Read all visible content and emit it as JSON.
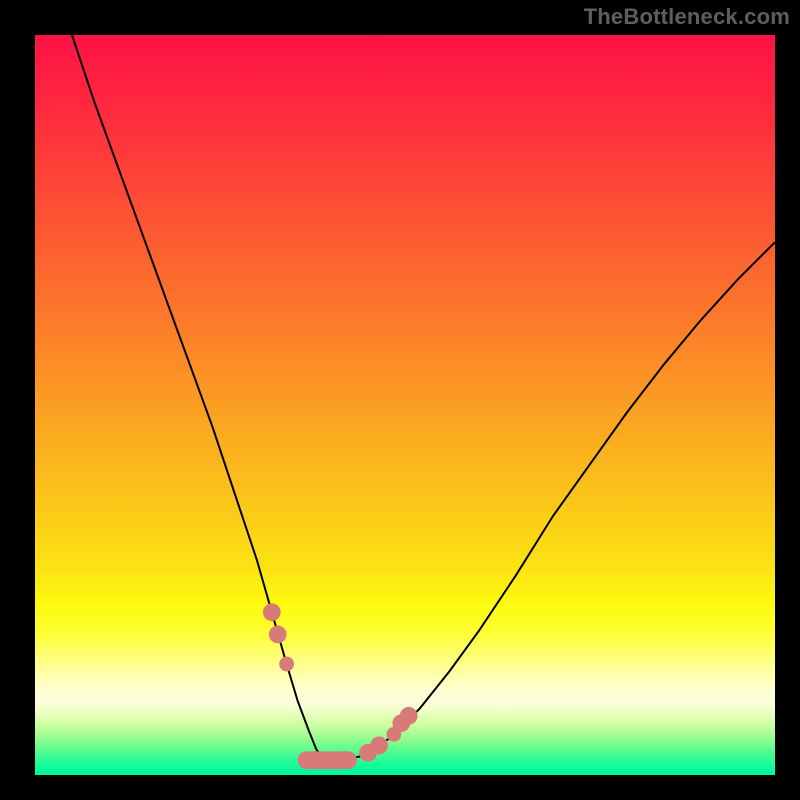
{
  "watermark": "TheBottleneck.com",
  "colors": {
    "marker": "#d87a77",
    "curve": "#000000",
    "frame": "#000000"
  },
  "gradient_stops": [
    {
      "offset": 0.0,
      "color": "#fe1245"
    },
    {
      "offset": 0.12,
      "color": "#fe2f3c"
    },
    {
      "offset": 0.25,
      "color": "#fd5433"
    },
    {
      "offset": 0.38,
      "color": "#fc792b"
    },
    {
      "offset": 0.5,
      "color": "#fb9e22"
    },
    {
      "offset": 0.62,
      "color": "#fbc31a"
    },
    {
      "offset": 0.72,
      "color": "#fbe313"
    },
    {
      "offset": 0.77,
      "color": "#fdfb0e"
    },
    {
      "offset": 0.808,
      "color": "#feff34"
    },
    {
      "offset": 0.848,
      "color": "#ffff89"
    },
    {
      "offset": 0.872,
      "color": "#ffffb9"
    },
    {
      "offset": 0.888,
      "color": "#ffffd5"
    },
    {
      "offset": 0.9,
      "color": "#fdffdb"
    },
    {
      "offset": 0.912,
      "color": "#f1ffc8"
    },
    {
      "offset": 0.924,
      "color": "#defeb1"
    },
    {
      "offset": 0.936,
      "color": "#c2fd9e"
    },
    {
      "offset": 0.948,
      "color": "#9efd91"
    },
    {
      "offset": 0.96,
      "color": "#71fc8e"
    },
    {
      "offset": 0.975,
      "color": "#3dfb94"
    },
    {
      "offset": 0.99,
      "color": "#0cfb9b"
    },
    {
      "offset": 1.0,
      "color": "#00f79d"
    }
  ],
  "chart_data": {
    "type": "line",
    "title": "",
    "xlabel": "",
    "ylabel": "",
    "xlim": [
      0,
      100
    ],
    "ylim": [
      0,
      100
    ],
    "series": [
      {
        "name": "bottleneck-curve",
        "x": [
          5,
          8,
          12,
          16,
          20,
          24,
          27,
          30,
          32,
          34,
          35.5,
          37,
          38,
          39,
          40,
          44,
          48,
          52,
          56,
          60,
          65,
          70,
          75,
          80,
          85,
          90,
          95,
          100
        ],
        "y": [
          100,
          91,
          80,
          69,
          58,
          47,
          38,
          29,
          22,
          15,
          10,
          6,
          3.5,
          2,
          2,
          2.5,
          5,
          9,
          14,
          19.5,
          27,
          35,
          42,
          49,
          55.5,
          61.5,
          67,
          72
        ]
      }
    ],
    "markers": [
      {
        "x": 32.0,
        "y": 22.0,
        "r": 1.2
      },
      {
        "x": 32.8,
        "y": 19.0,
        "r": 1.2
      },
      {
        "x": 34.0,
        "y": 15.0,
        "r": 1.0
      },
      {
        "x": 45.0,
        "y": 3.0,
        "r": 1.2
      },
      {
        "x": 46.5,
        "y": 4.0,
        "r": 1.2
      },
      {
        "x": 48.5,
        "y": 5.5,
        "r": 1.0
      },
      {
        "x": 49.5,
        "y": 7.0,
        "r": 1.2
      },
      {
        "x": 50.5,
        "y": 8.0,
        "r": 1.2
      }
    ],
    "bar_segment": {
      "x0": 35.5,
      "x1": 43.5,
      "y": 2.0,
      "thickness": 2.4
    }
  }
}
